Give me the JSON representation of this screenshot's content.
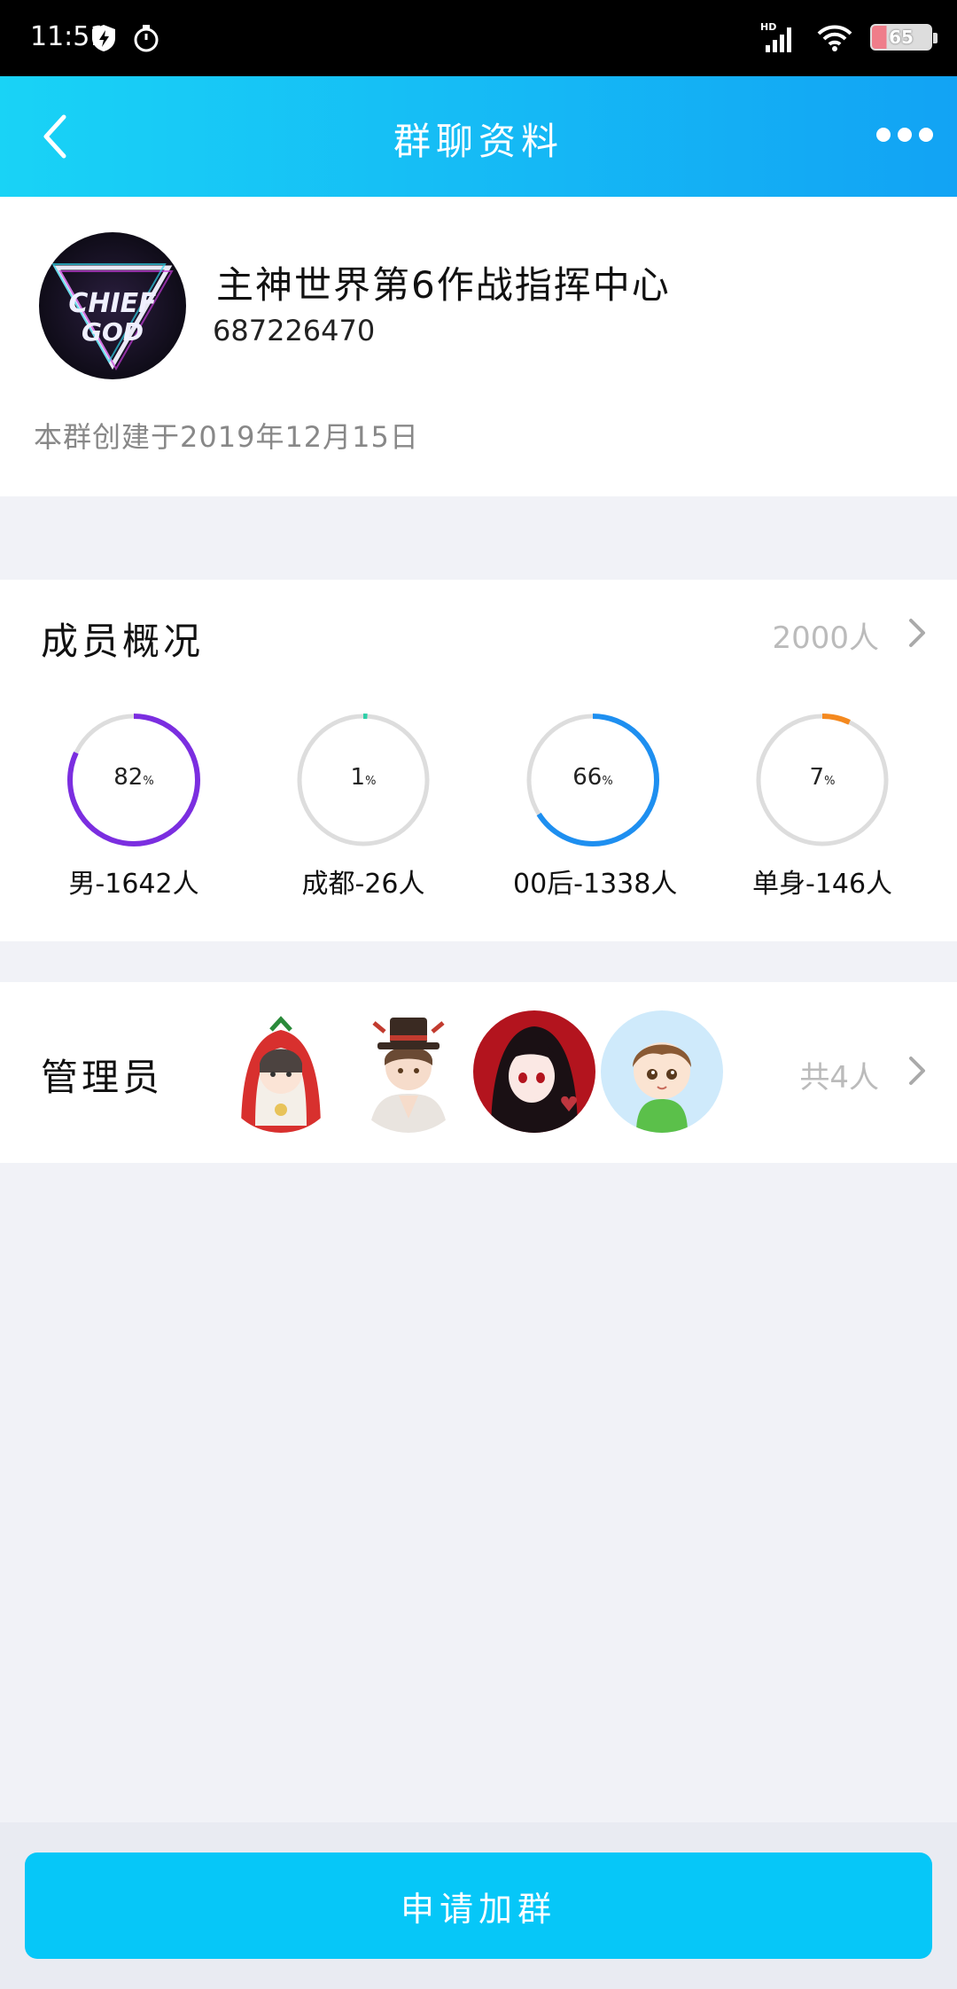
{
  "status_bar": {
    "time": "11:51",
    "network_label": "HD",
    "battery_level": "65"
  },
  "nav": {
    "title": "群聊资料"
  },
  "group": {
    "name": "主神世界第6作战指挥中心",
    "id": "687226470",
    "created": "本群创建于2019年12月15日",
    "avatar_text_top": "CHIEF",
    "avatar_text_bottom": "GOD"
  },
  "members": {
    "title": "成员概况",
    "count": "2000人",
    "stats": [
      {
        "percent": 82,
        "percent_text": "82",
        "unit": "%",
        "label": "男-1642人",
        "color": "#7b2ee0"
      },
      {
        "percent": 1,
        "percent_text": "1",
        "unit": "%",
        "label": "成都-26人",
        "color": "#2fcfa8"
      },
      {
        "percent": 66,
        "percent_text": "66",
        "unit": "%",
        "label": "00后-1338人",
        "color": "#1e8ff0"
      },
      {
        "percent": 7,
        "percent_text": "7",
        "unit": "%",
        "label": "单身-146人",
        "color": "#f4891f"
      }
    ]
  },
  "admins": {
    "title": "管理员",
    "count": "共4人"
  },
  "apply_button_label": "申请加群",
  "colors": {
    "nav_gradient_start": "#19d3f6",
    "nav_gradient_end": "#12a3f4",
    "button": "#06c7f8",
    "ring_track": "#dddddd"
  }
}
